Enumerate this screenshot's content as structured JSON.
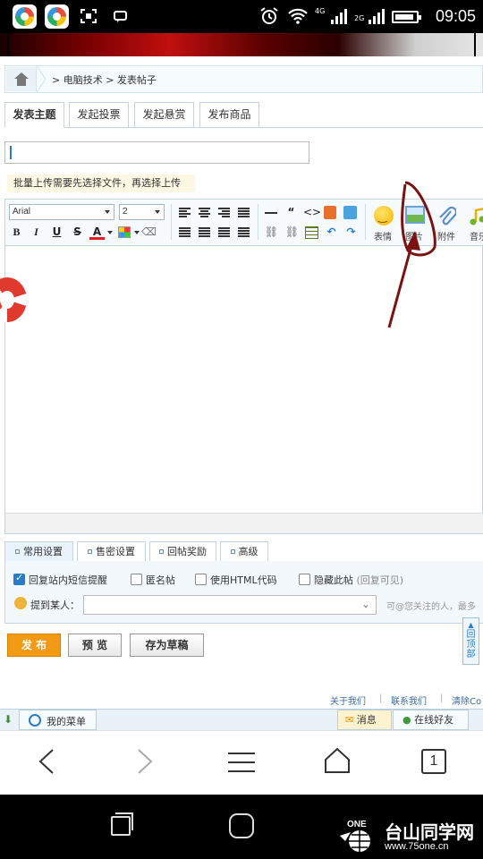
{
  "status_bar": {
    "time": "09:05",
    "network_4g": "4G",
    "network_2g": "2G",
    "icons": [
      "app-icon",
      "app-icon",
      "screenshot-icon",
      "message-icon",
      "alarm-icon",
      "wifi-icon",
      "signal-icon",
      "battery-icon"
    ]
  },
  "breadcrumb": {
    "items": [
      "> 电脑技术 > 发表帖子"
    ],
    "icon": "home-icon"
  },
  "tabs": [
    {
      "label": "发表主题",
      "active": true
    },
    {
      "label": "发起投票",
      "active": false
    },
    {
      "label": "发起悬赏",
      "active": false
    },
    {
      "label": "发布商品",
      "active": false
    }
  ],
  "subject": {
    "value": ""
  },
  "upload_tip": "批量上传需要先选择文件，再选择上传",
  "editor": {
    "font_family": "Arial",
    "font_size": "2",
    "toolbar_large": [
      {
        "label": "表情",
        "icon": "smiley-icon"
      },
      {
        "label": "图片",
        "icon": "image-icon"
      },
      {
        "label": "附件",
        "icon": "paperclip-icon"
      },
      {
        "label": "音乐",
        "icon": "music-icon"
      }
    ]
  },
  "settings_tabs": [
    {
      "label": "常用设置",
      "active": true
    },
    {
      "label": "售密设置",
      "active": false
    },
    {
      "label": "回帖奖励",
      "active": false
    },
    {
      "label": "高级",
      "active": false
    }
  ],
  "options": [
    {
      "label": "回复站内短信提醒",
      "checked": true
    },
    {
      "label": "匿名帖",
      "checked": false
    },
    {
      "label": "使用HTML代码",
      "checked": false
    },
    {
      "label": "隐藏此帖",
      "hint": "(回复可见)",
      "checked": false
    }
  ],
  "mention": {
    "label": "提到某人：",
    "hint": "可@您关注的人，最多"
  },
  "buttons": {
    "publish": "发 布",
    "preview": "预 览",
    "save_draft": "存为草稿"
  },
  "back_to_top": "回顶部",
  "footer_links": [
    "关于我们",
    "联系我们",
    "清除Co"
  ],
  "page_bar": {
    "my_menu": "我的菜单",
    "messages": "消息",
    "online_friends": "在线好友"
  },
  "browser_nav": {
    "tab_count": "1"
  },
  "watermark": {
    "name": "台山同学网",
    "url": "www.75one.cn",
    "logo_text": "ONE"
  },
  "annotation_color": "#7a1212",
  "accent_color": "#f39a14",
  "link_color": "#3a6a9e"
}
